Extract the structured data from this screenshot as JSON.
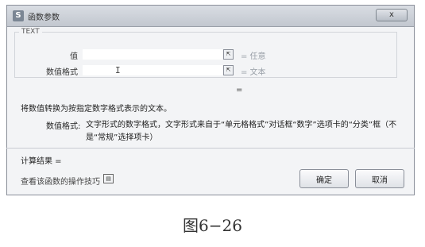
{
  "dialog": {
    "title": "函数参数",
    "app_icon_letter": "S",
    "close_glyph": "x",
    "group_title": "TEXT",
    "fields": [
      {
        "label": "值",
        "value": "",
        "pick_glyph": "⇱",
        "result": "= 任意"
      },
      {
        "label": "数值格式",
        "value": "",
        "pick_glyph": "⇱",
        "result": "= 文本"
      }
    ],
    "result_equals": "=",
    "description": "将数值转换为按指定数字格式表示的文本。",
    "param_name": "数值格式:",
    "param_description": "文字形式的数字格式，文字形式来自于“单元格格式”对话框“数字”选项卡的“分类”框（不是“常规”选择项卡）",
    "calc_result": "计算结果 =",
    "help_link": "查看该函数的操作技巧",
    "help_icon_glyph": "▤",
    "ok_label": "确定",
    "cancel_label": "取消"
  },
  "caption": "图6−26"
}
